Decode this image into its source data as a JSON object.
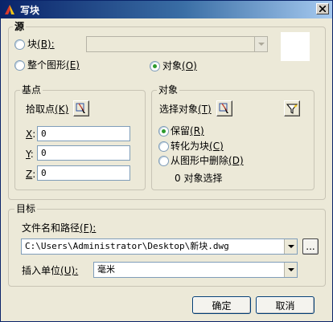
{
  "window": {
    "title": "写块",
    "app_icon": "autocad-icon"
  },
  "source": {
    "label": "源",
    "block_option": {
      "label": "块",
      "shortcut": "(B):",
      "checked": false
    },
    "entire_drawing_option": {
      "label": "整个图形",
      "shortcut": "(E)",
      "checked": false
    },
    "objects_option": {
      "label": "对象",
      "shortcut": "(O)",
      "checked": true
    }
  },
  "base_point": {
    "label": "基点",
    "pick_label": "拾取点",
    "pick_shortcut": "(K)",
    "x_label": "X",
    "x_value": "0",
    "y_label": "Y",
    "y_value": "0",
    "z_label": "Z",
    "z_value": "0"
  },
  "objects": {
    "label": "对象",
    "select_label": "选择对象",
    "select_shortcut": "(T)",
    "retain": {
      "label": "保留",
      "shortcut": "(R)",
      "checked": true
    },
    "convert": {
      "label": "转化为块",
      "shortcut": "(C)",
      "checked": false
    },
    "delete": {
      "label": "从图形中删除",
      "shortcut": "(D)",
      "checked": false
    },
    "status": "0 对象选择"
  },
  "destination": {
    "label": "目标",
    "file_label": "文件名和路径",
    "file_shortcut": "(F):",
    "file_value": "C:\\Users\\Administrator\\Desktop\\新块.dwg",
    "browse_label": "...",
    "units_label": "插入单位",
    "units_shortcut": "(U):",
    "units_value": "毫米"
  },
  "buttons": {
    "ok": "确定",
    "cancel": "取消"
  }
}
